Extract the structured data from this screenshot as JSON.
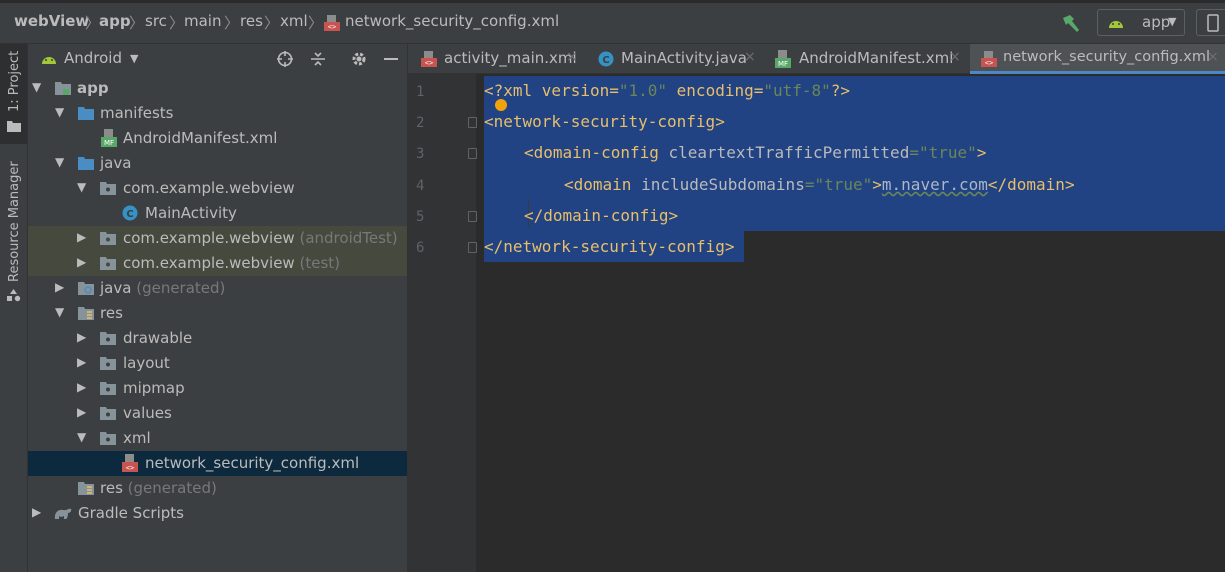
{
  "navbar": {
    "crumbs": [
      "webView",
      "app",
      "src",
      "main",
      "res",
      "xml",
      "network_security_config.xml"
    ],
    "run_config": "app"
  },
  "toolstrip": {
    "project_tab": "1: Project",
    "resource_manager_tab": "Resource Manager"
  },
  "panel": {
    "view_name": "Android"
  },
  "tree": [
    {
      "label": "app",
      "suffix": ""
    },
    {
      "label": "manifests",
      "suffix": ""
    },
    {
      "label": "AndroidManifest.xml",
      "suffix": ""
    },
    {
      "label": "java",
      "suffix": ""
    },
    {
      "label": "com.example.webview",
      "suffix": ""
    },
    {
      "label": "MainActivity",
      "suffix": ""
    },
    {
      "label": "com.example.webview",
      "suffix": "(androidTest)"
    },
    {
      "label": "com.example.webview",
      "suffix": "(test)"
    },
    {
      "label": "java",
      "suffix": "(generated)"
    },
    {
      "label": "res",
      "suffix": ""
    },
    {
      "label": "drawable",
      "suffix": ""
    },
    {
      "label": "layout",
      "suffix": ""
    },
    {
      "label": "mipmap",
      "suffix": ""
    },
    {
      "label": "values",
      "suffix": ""
    },
    {
      "label": "xml",
      "suffix": ""
    },
    {
      "label": "network_security_config.xml",
      "suffix": ""
    },
    {
      "label": "res",
      "suffix": "(generated)"
    },
    {
      "label": "Gradle Scripts",
      "suffix": ""
    }
  ],
  "tabs": [
    {
      "label": "activity_main.xml",
      "close": "×"
    },
    {
      "label": "MainActivity.java",
      "close": "×"
    },
    {
      "label": "AndroidManifest.xml",
      "close": "×"
    },
    {
      "label": "network_security_config.xml",
      "close": "×"
    }
  ],
  "editor": {
    "line_numbers": [
      "1",
      "2",
      "3",
      "4",
      "5",
      "6"
    ],
    "lines": {
      "l1": {
        "a": "<?xml version=",
        "b": "\"1.0\"",
        "c": " encoding=",
        "d": "\"utf-8\"",
        "e": "?>"
      },
      "l2": {
        "a": "<network-security-config>"
      },
      "l3": {
        "a": "<domain-config ",
        "b": "cleartextTrafficPermitted",
        "c": "=",
        "d": "\"true\"",
        "e": ">"
      },
      "l4": {
        "a": "<domain ",
        "b": "includeSubdomains",
        "c": "=",
        "d": "\"true\"",
        "e": ">",
        "f": "m.naver.com",
        "g": "</domain>"
      },
      "l5": {
        "a": "</domain-config>"
      },
      "l6": {
        "a": "</network-security-config>"
      }
    }
  },
  "colors": {
    "tag": "#e8bf6a",
    "attribute": "#bababa",
    "value": "#6a8759",
    "selection": "#214283",
    "tree_selected": "#0d293e",
    "tree_test_bg": "#45493e",
    "active_tab_underline": "#4a88c7"
  }
}
